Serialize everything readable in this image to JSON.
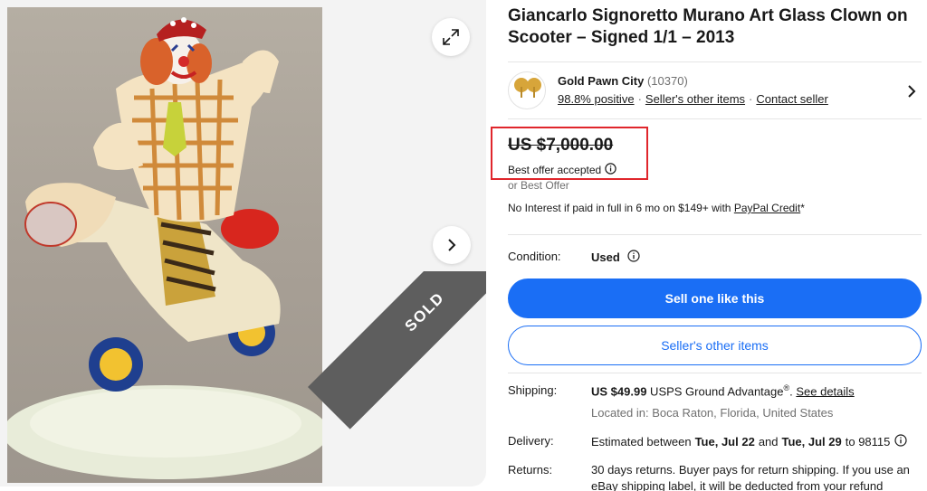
{
  "gallery": {
    "badge": "SOLD",
    "expand_icon": "expand-arrows-icon",
    "next_icon": "chevron-right-icon"
  },
  "listing": {
    "title": "Giancarlo Signoretto Murano Art Glass Clown on Scooter – Signed 1/1 – 2013"
  },
  "seller": {
    "name": "Gold Pawn City",
    "feedback_count": "(10370)",
    "positive": "98.8% positive",
    "other_items": "Seller's other items",
    "contact": "Contact seller",
    "logo_text": "Gold Pawn City",
    "logo_subtext": "Boca Raton"
  },
  "price": {
    "amount": "US $7,000.00",
    "best_offer_accepted": "Best offer accepted",
    "or_best_offer": "or Best Offer",
    "financing_text": "No Interest if paid in full in 6 mo on $149+ with ",
    "financing_link": "PayPal Credit",
    "financing_suffix": "*"
  },
  "condition": {
    "label": "Condition:",
    "value": "Used"
  },
  "buttons": {
    "sell_one": "Sell one like this",
    "sellers_other_items": "Seller's other items"
  },
  "shipping": {
    "label": "Shipping:",
    "price": "US $49.99",
    "service": " USPS Ground Advantage",
    "reg": "®",
    "dot": ". ",
    "details_link": "See details",
    "location": "Located in: Boca Raton, Florida, United States"
  },
  "delivery": {
    "label": "Delivery:",
    "prefix": "Estimated between",
    "start": "Tue, Jul 22",
    "and": "and",
    "end": "Tue, Jul 29",
    "suffix": "to 98115"
  },
  "returns": {
    "label": "Returns:",
    "text": "30 days returns. Buyer pays for return shipping. If you use an eBay shipping label, it will be deducted from your refund"
  },
  "colors": {
    "primary_blue": "#1a6ef5",
    "highlight_red": "#e0262c",
    "ribbon_gray": "#5e5e5e"
  }
}
